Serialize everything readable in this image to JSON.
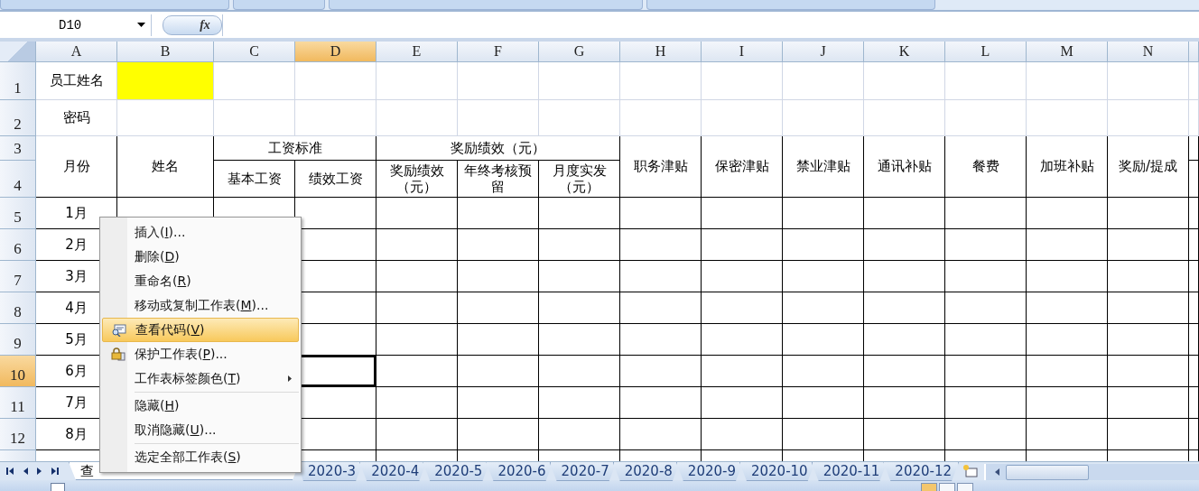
{
  "formula_bar": {
    "name_box": "D10",
    "fx_label": "fx"
  },
  "sheet": {
    "columns": [
      {
        "label": "A",
        "selected": false
      },
      {
        "label": "B",
        "selected": false
      },
      {
        "label": "C",
        "selected": false
      },
      {
        "label": "D",
        "selected": true
      },
      {
        "label": "E",
        "selected": false
      },
      {
        "label": "F",
        "selected": false
      },
      {
        "label": "G",
        "selected": false
      },
      {
        "label": "H",
        "selected": false
      },
      {
        "label": "I",
        "selected": false
      },
      {
        "label": "J",
        "selected": false
      },
      {
        "label": "K",
        "selected": false
      },
      {
        "label": "L",
        "selected": false
      },
      {
        "label": "M",
        "selected": false
      },
      {
        "label": "N",
        "selected": false
      }
    ],
    "rows": [
      {
        "label": "1",
        "selected": false
      },
      {
        "label": "2",
        "selected": false
      },
      {
        "label": "3",
        "selected": false
      },
      {
        "label": "4",
        "selected": false
      },
      {
        "label": "5",
        "selected": false
      },
      {
        "label": "6",
        "selected": false
      },
      {
        "label": "7",
        "selected": false
      },
      {
        "label": "8",
        "selected": false
      },
      {
        "label": "9",
        "selected": false
      },
      {
        "label": "10",
        "selected": true
      },
      {
        "label": "11",
        "selected": false
      },
      {
        "label": "12",
        "selected": false
      }
    ],
    "cells": [
      {
        "text": "员工姓名"
      },
      {
        "color": "#ffff00"
      },
      {
        "text": "密码"
      },
      {
        "text": "月份"
      },
      {
        "text": "姓名"
      },
      {
        "text": "工资标准"
      },
      {
        "text": "奖励绩效（元）"
      },
      {
        "text": "职务津贴"
      },
      {
        "text": "保密津贴"
      },
      {
        "text": "禁业津贴"
      },
      {
        "text": "通讯补贴"
      },
      {
        "text": "餐费"
      },
      {
        "text": "加班补贴"
      },
      {
        "text": "奖励/提成"
      },
      {
        "text": "基本工资"
      },
      {
        "text": "绩效工资"
      },
      {
        "text": "奖励绩效（元）"
      },
      {
        "text": "年终考核预留"
      },
      {
        "text": "月度实发（元）"
      },
      {
        "text": "1月"
      },
      {
        "text": "2月"
      },
      {
        "text": "3月"
      },
      {
        "text": "4月"
      },
      {
        "text": "5月"
      },
      {
        "text": "6月"
      },
      {
        "text": "7月"
      },
      {
        "text": "8月"
      }
    ]
  },
  "context_menu": [
    {
      "before": "插入(",
      "key": "I",
      "after": ")...",
      "selected": false
    },
    {
      "before": "删除(",
      "key": "D",
      "after": ")",
      "selected": false
    },
    {
      "before": "重命名(",
      "key": "R",
      "after": ")",
      "selected": false
    },
    {
      "before": "移动或复制工作表(",
      "key": "M",
      "after": ")...",
      "selected": false
    },
    {
      "before": "查看代码(",
      "key": "V",
      "after": ")",
      "selected": true
    },
    {
      "before": "保护工作表(",
      "key": "P",
      "after": ")...",
      "selected": false
    },
    {
      "before": "工作表标签颜色(",
      "key": "T",
      "after": ")",
      "selected": false,
      "submenu": true
    },
    {
      "before": "隐藏(",
      "key": "H",
      "after": ")",
      "selected": false,
      "separator_before": true
    },
    {
      "before": "取消隐藏(",
      "key": "U",
      "after": ")...",
      "selected": false
    },
    {
      "before": "选定全部工作表(",
      "key": "S",
      "after": ")",
      "selected": false,
      "separator_before": true
    }
  ],
  "sheet_tabs": [
    {
      "label": "查",
      "selected": true
    },
    {
      "label": "2020-3",
      "selected": false
    },
    {
      "label": "2020-4",
      "selected": false
    },
    {
      "label": "2020-5",
      "selected": false
    },
    {
      "label": "2020-6",
      "selected": false
    },
    {
      "label": "2020-7",
      "selected": false
    },
    {
      "label": "2020-8",
      "selected": false
    },
    {
      "label": "2020-9",
      "selected": false
    },
    {
      "label": "2020-10",
      "selected": false
    },
    {
      "label": "2020-11",
      "selected": false
    },
    {
      "label": "2020-12",
      "selected": false
    }
  ]
}
